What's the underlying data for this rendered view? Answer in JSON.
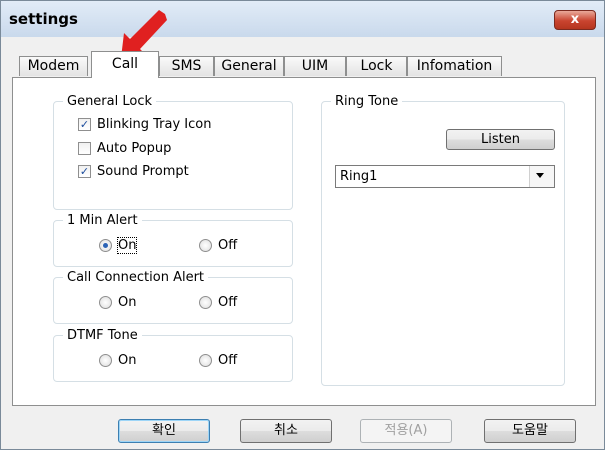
{
  "window": {
    "title": "settings",
    "close_symbol": "x"
  },
  "tabs": [
    {
      "label": "Modem",
      "active": false
    },
    {
      "label": "Call",
      "active": true
    },
    {
      "label": "SMS",
      "active": false
    },
    {
      "label": "General",
      "active": false
    },
    {
      "label": "UIM",
      "active": false
    },
    {
      "label": "Lock",
      "active": false
    },
    {
      "label": "Infomation",
      "active": false
    }
  ],
  "general_lock": {
    "label": "General Lock",
    "options": [
      {
        "label": "Blinking Tray Icon",
        "checked": true
      },
      {
        "label": "Auto Popup",
        "checked": false
      },
      {
        "label": "Sound Prompt",
        "checked": true
      }
    ]
  },
  "min_alert": {
    "label": "1 Min Alert",
    "on": "On",
    "off": "Off",
    "selected": "On"
  },
  "call_connection_alert": {
    "label": "Call Connection Alert",
    "on": "On",
    "off": "Off",
    "selected": null
  },
  "dtmf_tone": {
    "label": "DTMF Tone",
    "on": "On",
    "off": "Off",
    "selected": null
  },
  "ring_tone": {
    "label": "Ring Tone",
    "listen_label": "Listen",
    "selected": "Ring1"
  },
  "buttons": {
    "ok": "확인",
    "cancel": "취소",
    "apply": "적용(A)",
    "help": "도움말"
  },
  "check_symbol": "✓",
  "annotation": {
    "type": "red-arrow",
    "color": "#e02020"
  }
}
